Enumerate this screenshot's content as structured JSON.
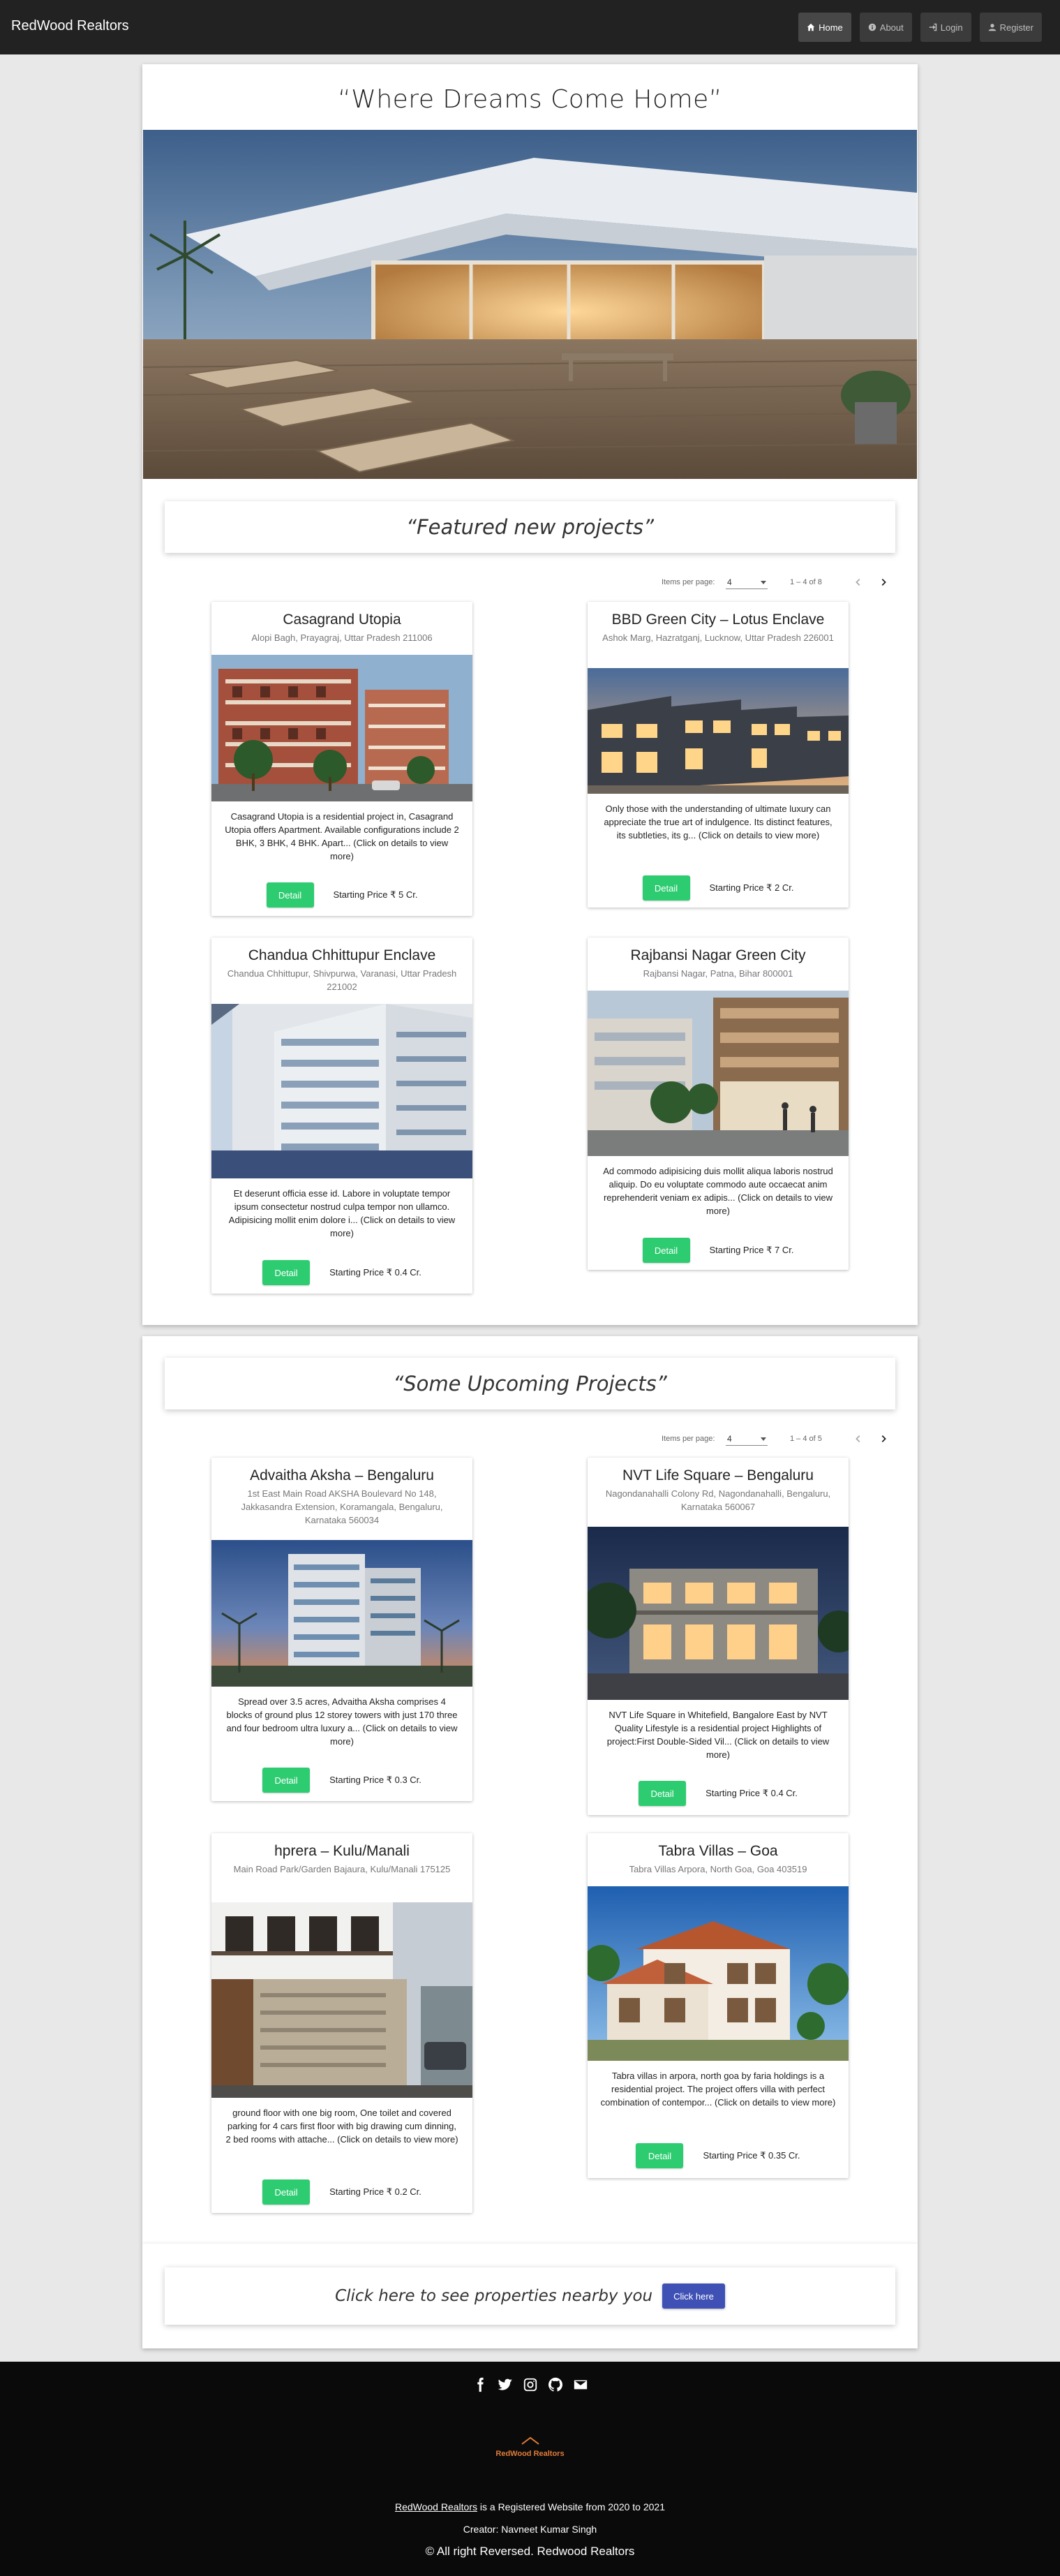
{
  "navbar": {
    "brand": "RedWood Realtors",
    "links": [
      {
        "label": "Home",
        "icon": "home-icon"
      },
      {
        "label": "About",
        "icon": "info-icon"
      },
      {
        "label": "Login",
        "icon": "login-icon"
      },
      {
        "label": "Register",
        "icon": "user-icon"
      }
    ]
  },
  "hero": {
    "tagline": "“Where Dreams Come Home”"
  },
  "featured": {
    "heading": "“Featured new projects”",
    "paginator": {
      "label": "Items per page:",
      "page_size": "4",
      "range": "1 – 4 of 8"
    },
    "cards": [
      {
        "title": "Casagrand Utopia",
        "address": "Alopi Bagh, Prayagraj, Uttar Pradesh 211006",
        "description": "Casagrand Utopia is a residential project in, Casagrand Utopia offers Apartment. Available configurations include 2 BHK, 3 BHK, 4 BHK. Apart... (Click on details to view more)",
        "button": "Detail",
        "price": "Starting Price ₹ 5 Cr."
      },
      {
        "title": "BBD Green City – Lotus Enclave",
        "address": "Ashok Marg, Hazratganj, Lucknow, Uttar Pradesh 226001",
        "description": "Only those with the understanding of ultimate luxury can appreciate the true art of indulgence. Its distinct features, its subtleties, its g... (Click on details to view more)",
        "button": "Detail",
        "price": "Starting Price ₹ 2 Cr."
      },
      {
        "title": "Chandua Chhittupur Enclave",
        "address": "Chandua Chhittupur, Shivpurwa, Varanasi, Uttar Pradesh 221002",
        "description": "Et deserunt officia esse id. Labore in voluptate tempor ipsum consectetur nostrud culpa tempor non ullamco. Adipisicing mollit enim dolore i... (Click on details to view more)",
        "button": "Detail",
        "price": "Starting Price ₹ 0.4 Cr."
      },
      {
        "title": "Rajbansi Nagar Green City",
        "address": "Rajbansi Nagar, Patna, Bihar 800001",
        "description": "Ad commodo adipisicing duis mollit aliqua laboris nostrud aliquip. Do eu voluptate commodo aute occaecat anim reprehenderit veniam ex adipis... (Click on details to view more)",
        "button": "Detail",
        "price": "Starting Price ₹ 7 Cr."
      }
    ]
  },
  "upcoming": {
    "heading": "“Some Upcoming Projects”",
    "paginator": {
      "label": "Items per page:",
      "page_size": "4",
      "range": "1 – 4 of 5"
    },
    "cards": [
      {
        "title": "Advaitha Aksha – Bengaluru",
        "address": "1st East Main Road AKSHA Boulevard No 148, Jakkasandra Extension, Koramangala, Bengaluru, Karnataka 560034",
        "description": "Spread over 3.5 acres, Advaitha Aksha comprises 4 blocks of ground plus 12 storey towers with just 170 three and four bedroom ultra luxury a... (Click on details to view more)",
        "button": "Detail",
        "price": "Starting Price ₹ 0.3 Cr."
      },
      {
        "title": "NVT Life Square – Bengaluru",
        "address": "Nagondanahalli Colony Rd, Nagondanahalli, Bengaluru, Karnataka 560067",
        "description": "NVT Life Square in Whitefield, Bangalore East by NVT Quality Lifestyle is a residential project Highlights of project:First Double-Sided Vil... (Click on details to view more)",
        "button": "Detail",
        "price": "Starting Price ₹ 0.4 Cr."
      },
      {
        "title": "hprera – Kulu/Manali",
        "address": "Main Road Park/Garden Bajaura, Kulu/Manali 175125",
        "description": "ground floor with one big room, One toilet and covered parking for 4 cars first floor with big drawing cum dinning, 2 bed rooms with attache... (Click on details to view more)",
        "button": "Detail",
        "price": "Starting Price ₹ 0.2 Cr."
      },
      {
        "title": "Tabra Villas – Goa",
        "address": "Tabra Villas Arpora, North Goa, Goa 403519",
        "description": "Tabra villas in arpora, north goa by faria holdings is a residential project. The project offers villa with perfect combination of contempor... (Click on details to view more)",
        "button": "Detail",
        "price": "Starting Price ₹ 0.35 Cr."
      }
    ]
  },
  "nearby": {
    "text": "Click here to see properties nearby you",
    "button": "Click here"
  },
  "footer": {
    "social_icons": [
      "facebook-icon",
      "twitter-icon",
      "instagram-icon",
      "github-icon",
      "envelope-icon"
    ],
    "logo_text": "RedWood Realtors",
    "registered_link": "RedWood Realtors",
    "registered_text": " is a Registered Website from 2020 to 2021",
    "creator": "Creator: Navneet Kumar Singh",
    "copyright": "© All right Reversed.  Redwood Realtors"
  },
  "colors": {
    "navbar": "#222222",
    "detail_button": "#2ecc71",
    "nearby_button": "#3f51b5",
    "footer": "#0a0a0a",
    "logo_accent": "#e07b39"
  }
}
